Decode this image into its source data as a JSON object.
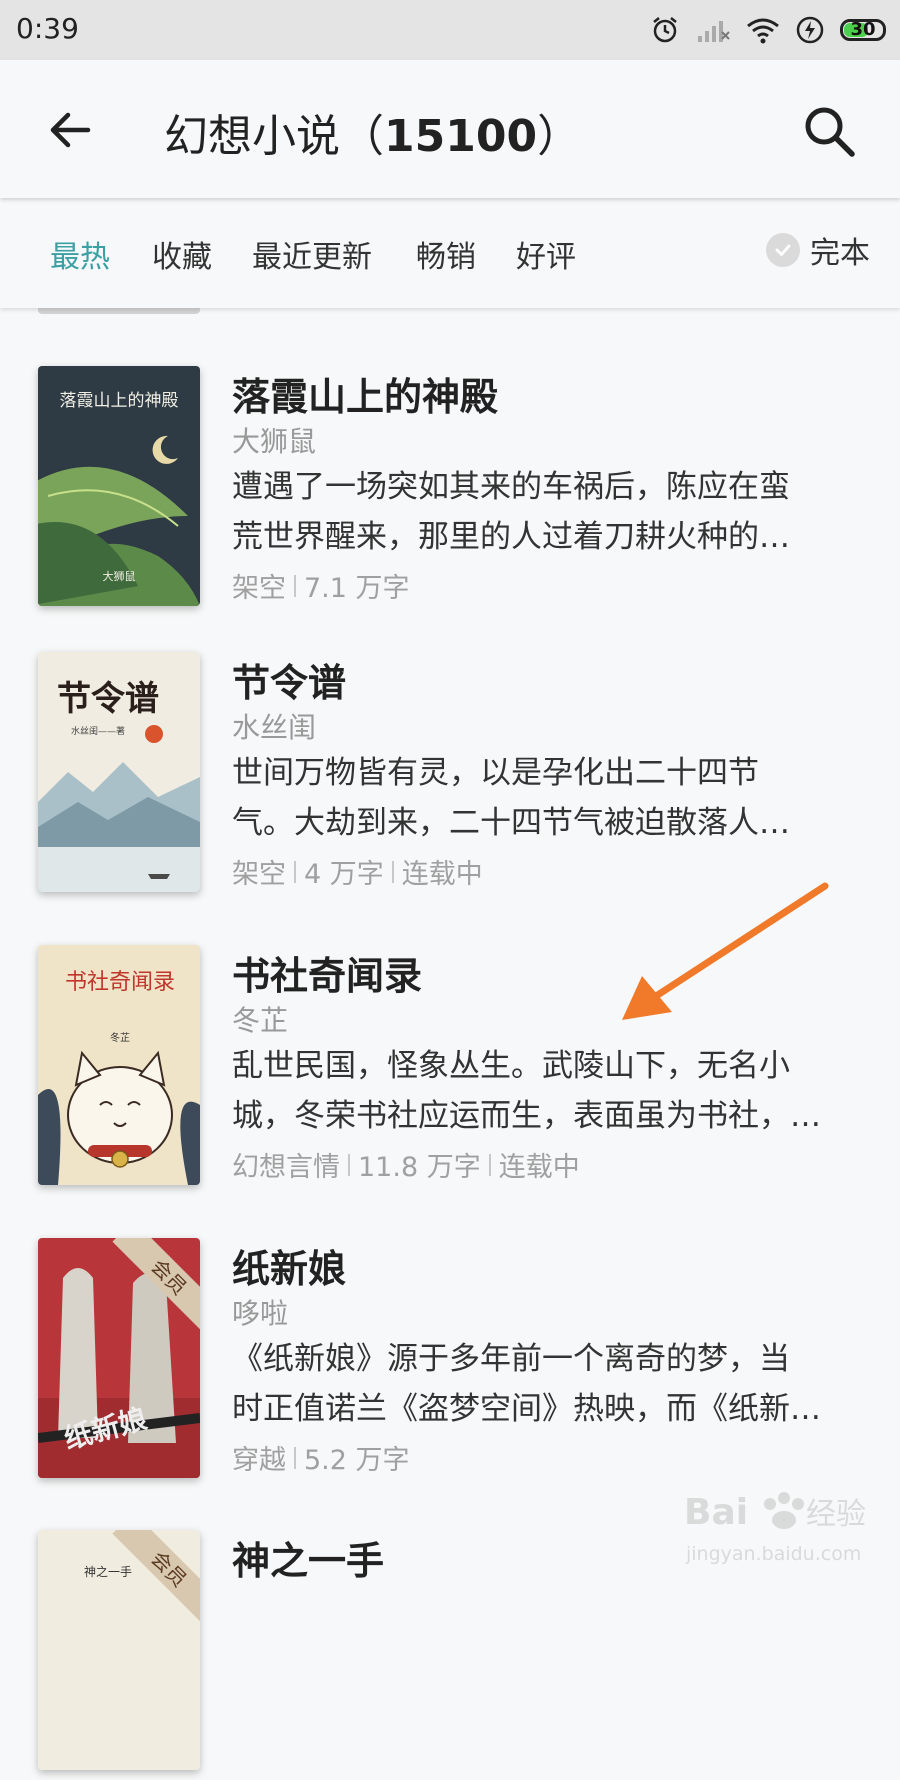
{
  "status_bar": {
    "time": "0:39",
    "battery": "30"
  },
  "header": {
    "title": "幻想小说（",
    "count": "15100",
    "title_suffix": "）"
  },
  "filters": {
    "tabs": [
      {
        "label": "最热",
        "active": true
      },
      {
        "label": "收藏",
        "active": false
      },
      {
        "label": "最近更新",
        "active": false
      },
      {
        "label": "畅销",
        "active": false
      },
      {
        "label": "好评",
        "active": false
      }
    ],
    "complete_label": "完本",
    "active_color": "#3aa0a4"
  },
  "books": [
    {
      "title": "落霞山上的神殿",
      "author": "大狮鼠",
      "desc_lines": [
        "遭遇了一场突如其来的车祸后，陈应在蛮",
        "荒世界醒来，那里的人过着刀耕火种的…"
      ],
      "meta": [
        "架空",
        "7.1 万字"
      ],
      "cover": {
        "title_text": "落霞山上的神殿",
        "author_text": "大狮鼠",
        "icon": "leaf-moon-cover"
      }
    },
    {
      "title": "节令谱",
      "author": "水丝闺",
      "desc_lines": [
        "世间万物皆有灵，以是孕化出二十四节",
        "气。大劫到来，二十四节气被迫散落人…"
      ],
      "meta": [
        "架空",
        "4 万字",
        "连载中"
      ],
      "cover": {
        "title_text": "节令谱",
        "author_text": "水丝闺——著",
        "icon": "landscape-cover"
      }
    },
    {
      "title": "书社奇闻录",
      "author": "冬芷",
      "desc_lines": [
        "乱世民国，怪象丛生。武陵山下，无名小",
        "城，冬荣书社应运而生，表面虽为书社，…"
      ],
      "meta": [
        "幻想言情",
        "11.8 万字",
        "连载中"
      ],
      "cover": {
        "title_text": "书社奇闻录",
        "author_text": "冬芷",
        "icon": "lucky-cat-cover"
      }
    },
    {
      "title": "纸新娘",
      "author": "哆啦",
      "desc_lines": [
        "《纸新娘》源于多年前一个离奇的梦，当",
        "时正值诺兰《盗梦空间》热映，而《纸新…"
      ],
      "meta": [
        "穿越",
        "5.2 万字"
      ],
      "cover": {
        "title_text": "纸新娘",
        "badge": "会员",
        "icon": "paper-bride-cover"
      }
    },
    {
      "title": "神之一手",
      "author": "",
      "desc_lines": [],
      "meta": [],
      "cover": {
        "title_text": "神之一手",
        "badge": "会员",
        "icon": "go-board-cover"
      }
    }
  ],
  "watermark": {
    "brand": "Bai",
    "brand2": "经验",
    "url": "jingyan.baidu.com"
  },
  "annotation": {
    "arrow_color": "#f07a2a"
  }
}
